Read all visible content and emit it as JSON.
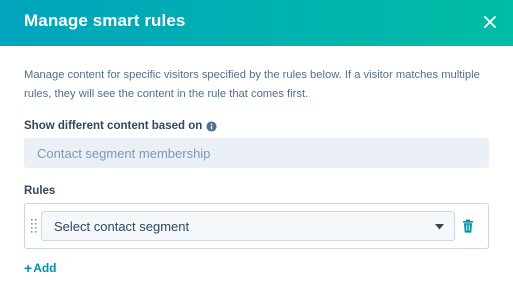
{
  "dialog": {
    "title": "Manage smart rules",
    "description": "Manage content for specific visitors specified by the rules below. If a visitor matches multiple rules, they will see the content in the rule that comes first.",
    "show_content_label": "Show different content based on",
    "show_content_value": "Contact segment membership",
    "rules_label": "Rules",
    "rules": [
      {
        "select_value": "Select contact segment"
      }
    ],
    "add_label": "Add",
    "add_symbol": "+",
    "colors": {
      "header_gradient_start": "#00a4bd",
      "header_gradient_end": "#00bda5",
      "link": "#0091ae"
    },
    "icons": {
      "close": "close-icon",
      "info": "info-icon",
      "drag": "drag-handle-icon",
      "caret": "caret-down-icon",
      "delete": "trash-icon",
      "add": "plus-icon"
    }
  }
}
